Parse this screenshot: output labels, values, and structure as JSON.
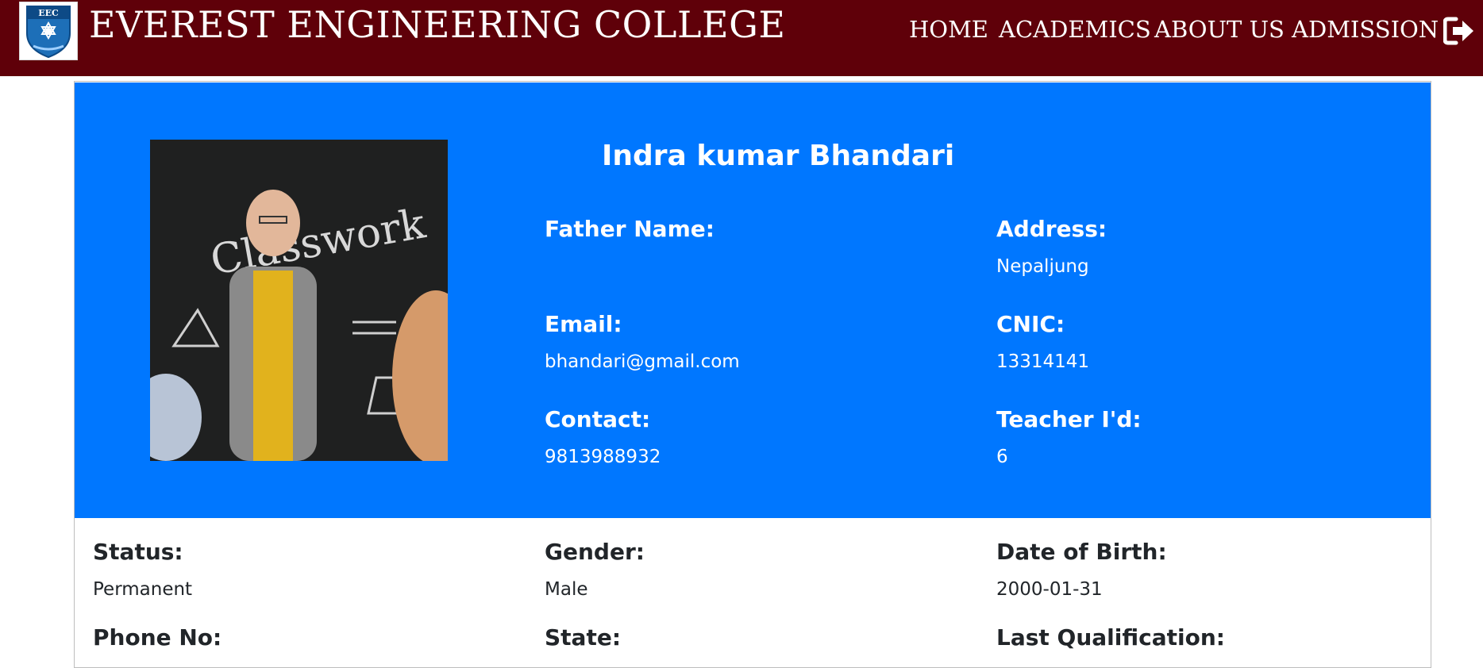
{
  "header": {
    "brand": "EVEREST ENGINEERING COLLEGE",
    "logo_text": "EEC",
    "nav": [
      "HOME",
      "ACADEMICS",
      "ABOUT US",
      "ADMISSION"
    ],
    "logout_icon": "sign-out-icon",
    "background": "#5f0009"
  },
  "profile": {
    "name": "Indra kumar Bhandari",
    "hero_color": "#0077ff",
    "photo_text": "Classwork",
    "fields": {
      "father_name": {
        "label": "Father Name:",
        "value": ""
      },
      "address": {
        "label": "Address:",
        "value": "Nepaljung"
      },
      "email": {
        "label": "Email:",
        "value": "bhandari@gmail.com"
      },
      "cnic": {
        "label": "CNIC:",
        "value": "13314141"
      },
      "contact": {
        "label": "Contact:",
        "value": "9813988932"
      },
      "teacher_id": {
        "label": "Teacher I'd:",
        "value": "6"
      }
    }
  },
  "details": {
    "status": {
      "label": "Status:",
      "value": "Permanent"
    },
    "gender": {
      "label": "Gender:",
      "value": "Male"
    },
    "dob": {
      "label": "Date of Birth:",
      "value": "2000-01-31"
    },
    "phone": {
      "label": "Phone No:",
      "value": ""
    },
    "state": {
      "label": "State:",
      "value": ""
    },
    "last_qualification": {
      "label": "Last Qualification:",
      "value": ""
    }
  }
}
